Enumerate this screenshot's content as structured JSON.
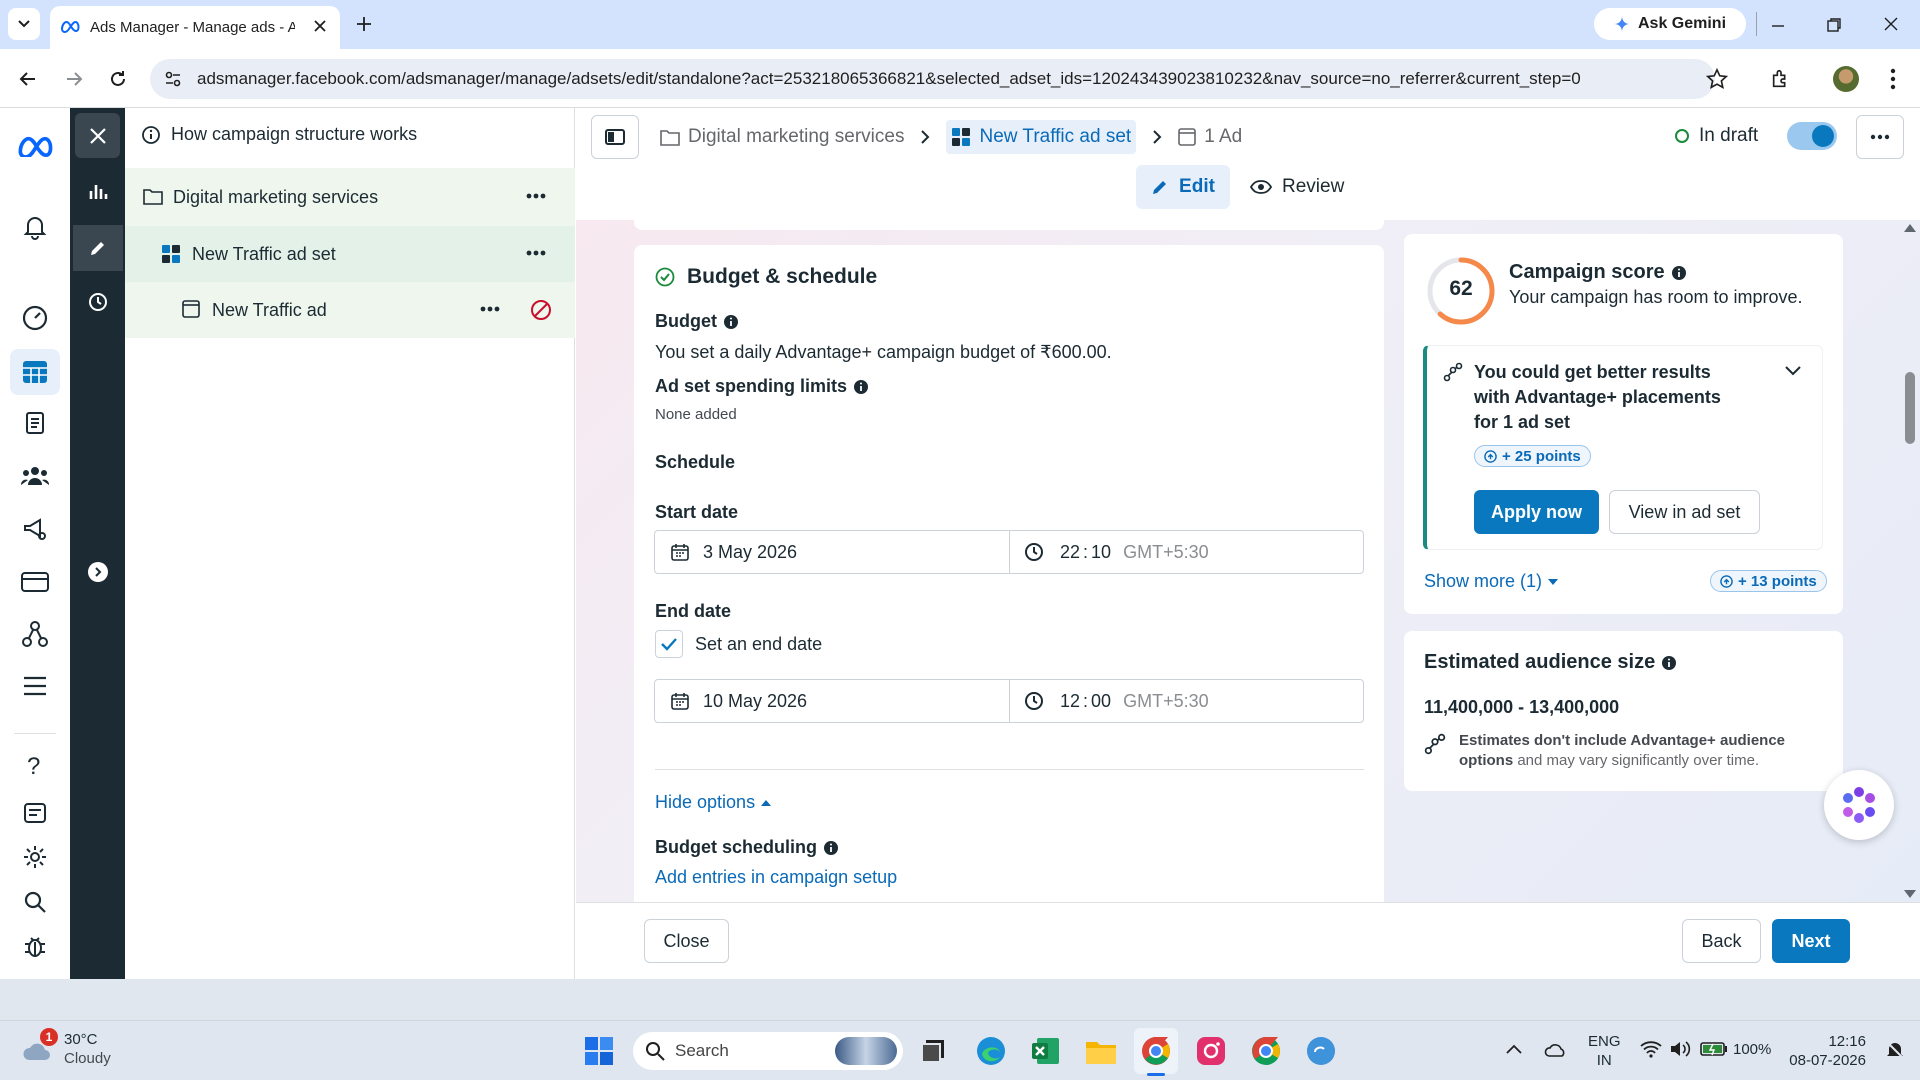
{
  "browser": {
    "tab_title": "Ads Manager - Manage ads - A",
    "ask_gemini": "Ask Gemini",
    "url": "adsmanager.facebook.com/adsmanager/manage/adsets/edit/standalone?act=253218065366821&selected_adset_ids=120243439023810232&nav_source=no_referrer&current_step=0"
  },
  "tree": {
    "help_text": "How campaign structure works",
    "campaign": "Digital marketing services",
    "adset": "New Traffic ad set",
    "ad": "New Traffic ad"
  },
  "header": {
    "crumb_campaign": "Digital marketing services",
    "crumb_adset": "New Traffic ad set",
    "crumb_ad": "1 Ad",
    "status": "In draft",
    "edit": "Edit",
    "review": "Review"
  },
  "budget": {
    "section_title": "Budget & schedule",
    "budget_label": "Budget",
    "budget_text": "You set a daily Advantage+ campaign budget of ₹600.00.",
    "limits_label": "Ad set spending limits",
    "limits_value": "None added",
    "schedule_label": "Schedule",
    "start_label": "Start date",
    "start_date": "3 May 2026",
    "start_hour": "22",
    "start_min": "10",
    "timezone": "GMT+5:30",
    "end_label": "End date",
    "end_checkbox": "Set an end date",
    "end_date": "10 May 2026",
    "end_hour": "12",
    "end_min": "00",
    "hide_options": "Hide options",
    "scheduling_label": "Budget scheduling",
    "scheduling_link": "Add entries in campaign setup"
  },
  "score": {
    "value": "62",
    "title": "Campaign score",
    "subtitle": "Your campaign has room to improve.",
    "rec_line1": "You could get better results",
    "rec_line2": "with Advantage+ placements",
    "rec_line3": "for 1 ad set",
    "rec_points": "+ 25 points",
    "apply": "Apply now",
    "view": "View in ad set",
    "show_more": "Show more (1)",
    "more_points": "+ 13 points"
  },
  "audience": {
    "title": "Estimated audience size",
    "range": "11,400,000 - 13,400,000",
    "note_bold": "Estimates don't include Advantage+ audience options",
    "note_rest": " and may vary significantly over time."
  },
  "footer": {
    "close": "Close",
    "back": "Back",
    "next": "Next"
  },
  "taskbar": {
    "weather_badge": "1",
    "temp": "30°C",
    "weather": "Cloudy",
    "search": "Search",
    "lang1": "ENG",
    "lang2": "IN",
    "battery": "100%",
    "time": "12:16",
    "date": "08-07-2026"
  },
  "colors": {
    "accent": "#0a78be",
    "dark_rail": "#1c2b33",
    "tab_bar": "#d3e3fd"
  }
}
